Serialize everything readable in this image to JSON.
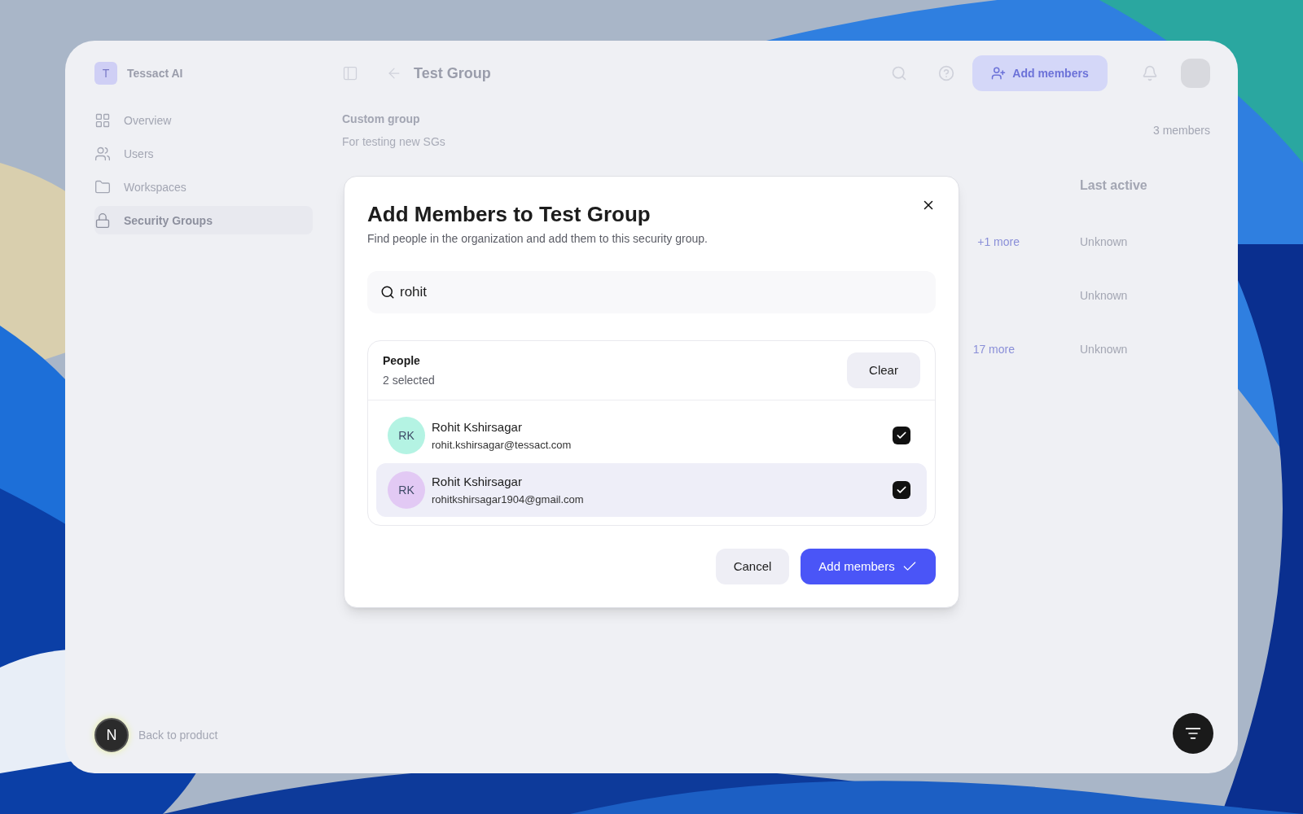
{
  "app": {
    "logo_letter": "T",
    "name": "Tessact AI"
  },
  "sidebar": {
    "items": [
      {
        "label": "Overview",
        "kind": "grid",
        "selected": false
      },
      {
        "label": "Users",
        "kind": "users",
        "selected": false
      },
      {
        "label": "Workspaces",
        "kind": "folder",
        "selected": false
      },
      {
        "label": "Security Groups",
        "kind": "lock",
        "selected": true
      }
    ],
    "footer": "Back to product"
  },
  "header": {
    "title": "Test Group",
    "add_button": "Add members"
  },
  "group": {
    "type": "Custom group",
    "description": "For testing new SGs",
    "member_count": "3 members"
  },
  "table": {
    "columns": [
      "Last active"
    ],
    "rows": [
      {
        "tag": "+1 more",
        "last_active": "Unknown"
      },
      {
        "last_active": "Unknown"
      },
      {
        "tag": "17 more",
        "last_active": "Unknown"
      }
    ]
  },
  "dialog": {
    "title": "Add Members to Test Group",
    "subtitle": "Find people in the organization and add them to this security group.",
    "search": {
      "value": "rohit"
    },
    "people": {
      "heading": "People",
      "count": "2 selected",
      "clear": "Clear",
      "results": [
        {
          "initials": "RK",
          "name": "Rohit Kshirsagar",
          "email": "rohit.kshirsagar@tessact.com",
          "color": "#b4f3e3",
          "checked": true,
          "highlighted": false
        },
        {
          "initials": "RK",
          "name": "Rohit Kshirsagar",
          "email": "rohitkshirsagar1904@gmail.com",
          "color": "#e2c9f4",
          "checked": true,
          "highlighted": true
        }
      ]
    },
    "buttons": {
      "cancel": "Cancel",
      "confirm": "Add members"
    }
  },
  "dev_badge": {
    "letter": "N"
  }
}
